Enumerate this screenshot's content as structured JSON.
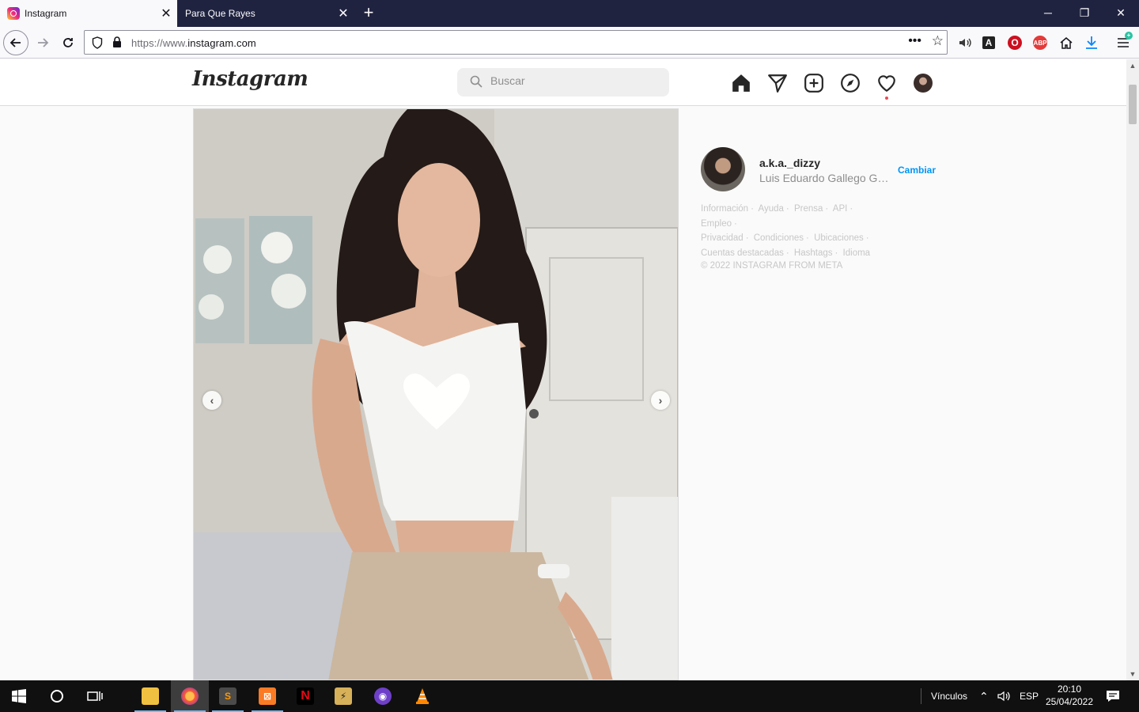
{
  "browser": {
    "tabs": [
      {
        "title": "Instagram",
        "active": true
      },
      {
        "title": "Para Que Rayes",
        "active": false
      }
    ],
    "url": "https://www.instagram.com",
    "url_host": "instagram.com",
    "url_prefix": "https://www."
  },
  "instagram": {
    "logo": "Instagram",
    "search": {
      "placeholder": "Buscar"
    },
    "profile": {
      "username": "a.k.a._dizzy",
      "full_name": "Luis Eduardo Gallego Gar...",
      "switch_label": "Cambiar"
    },
    "footer_links": [
      "Información",
      "Ayuda",
      "Prensa",
      "API",
      "Empleo",
      "Privacidad",
      "Condiciones",
      "Ubicaciones",
      "Cuentas destacadas",
      "Hashtags",
      "Idioma"
    ],
    "copyright": "© 2022 INSTAGRAM FROM META"
  },
  "taskbar": {
    "links_label": "Vínculos",
    "lang": "ESP",
    "time": "20:10",
    "date": "25/04/2022"
  },
  "colors": {
    "tabbar": "#202340",
    "accent_blue": "#0095f6",
    "notification": "#ed4956"
  }
}
